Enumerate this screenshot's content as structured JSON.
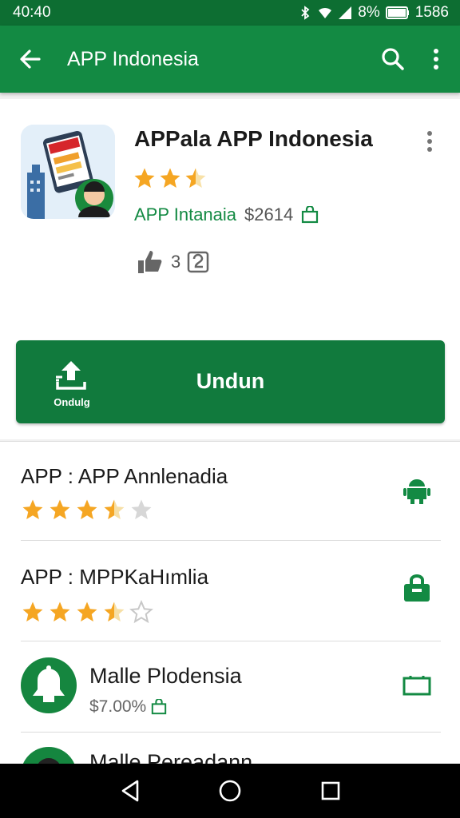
{
  "status_bar": {
    "time": "40:40",
    "battery_pct": "8%",
    "right_clock": "1586"
  },
  "app_bar": {
    "title": "APP Indonesia"
  },
  "header": {
    "app_name": "APPala APP Indonesia",
    "rating": 2.5,
    "developer": "APP Intanaia",
    "price": "$2614",
    "meta_count": "3"
  },
  "install_button": {
    "label": "Undun",
    "icon_label": "Ondulg"
  },
  "list": [
    {
      "name": "APP : APP Annlenadia",
      "rating": 3.5,
      "icon": "android-icon"
    },
    {
      "name": "APP : MPPKaHımlia",
      "rating": 3.5,
      "icon": "shop-bag-icon"
    },
    {
      "name": "Malle Plodensia",
      "price": "$7.00%",
      "icon": "screen-icon"
    },
    {
      "name": "Malle Pereadann"
    }
  ],
  "colors": {
    "primary": "#138a43",
    "status_bar": "#0d6e32",
    "button": "#117a3d",
    "star": "#f5a623"
  }
}
